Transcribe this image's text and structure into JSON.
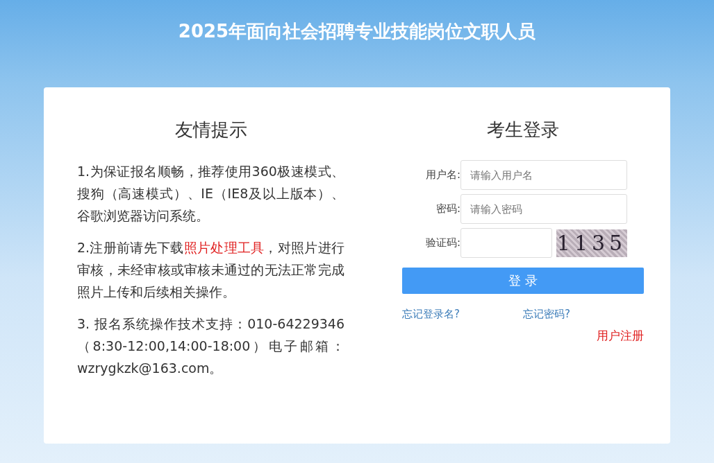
{
  "header": {
    "title": "2025年面向社会招聘专业技能岗位文职人员"
  },
  "notice": {
    "title": "友情提示",
    "paragraphs": [
      {
        "text": "1.为保证报名顺畅，推荐使用360极速模式、搜狗（高速模式）、IE（IE8及以上版本）、谷歌浏览器访问系统。"
      },
      {
        "before": "2.注册前请先下载",
        "link": "照片处理工具",
        "after": "，对照片进行审核，未经审核或审核未通过的无法正常完成照片上传和后续相关操作。"
      },
      {
        "text": "3. 报名系统操作技术支持：010-64229346 （8:30-12:00,14:00-18:00）电子邮箱：wzrygkzk@163.com。"
      }
    ]
  },
  "login": {
    "title": "考生登录",
    "fields": [
      {
        "kind": "text",
        "label": "用户名:",
        "placeholder": "请输入用户名"
      },
      {
        "kind": "password",
        "label": "密码:",
        "placeholder": "请输入密码"
      },
      {
        "kind": "captcha",
        "label": "验证码:",
        "captcha": "1135"
      }
    ],
    "submit": "登 录",
    "forgot_username": "忘记登录名?",
    "forgot_password": "忘记密码?",
    "register": "用户注册"
  }
}
